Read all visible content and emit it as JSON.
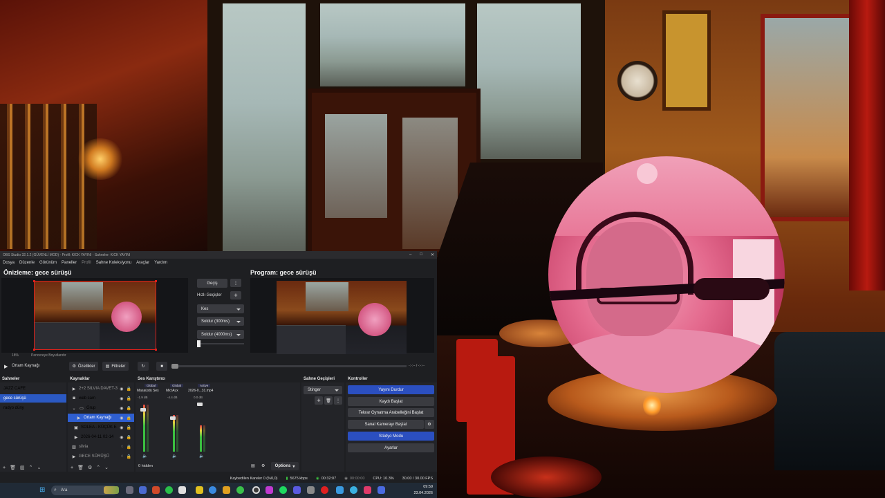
{
  "obs": {
    "title_bar": "OBS Studio 32.1.2 (GÜVENLİ MOD) - Profil: KICK YAYINI - Sahneler: KICK YAYINI",
    "menu": [
      "Dosya",
      "Düzenle",
      "Görünüm",
      "Paneller",
      "Profil",
      "Sahne Koleksiyonu",
      "Araçlar",
      "Yardım"
    ],
    "preview_title": "Önizleme: gece sürüşü",
    "program_title": "Program: gece sürüşü",
    "zoom": "18%",
    "preview_hint": "Pencereye Boyutlandır",
    "transition": {
      "button": "Geçiş",
      "quick_label": "Hızlı Geçişler",
      "items": [
        "Kes",
        "Soldur (300ms)",
        "Soldur (4000ms)"
      ]
    },
    "media": {
      "source": "Ortam Kaynağı",
      "properties": "Özellikler",
      "filters": "Filtreler",
      "time": "-:-:-- / -:-:--"
    },
    "scenes": {
      "header": "Sahneler",
      "items": [
        "JAZZ CAFE",
        "gece sürüşü",
        "radyo düny"
      ],
      "active_index": 1
    },
    "sources": {
      "header": "Kaynaklar",
      "items": [
        {
          "label": "2+2 SILVIA DAVET-3",
          "icon": "play-icon",
          "dim": true
        },
        {
          "label": "web cam",
          "icon": "camera-icon",
          "dim": false
        },
        {
          "label": "Grup",
          "icon": "folder-icon",
          "dim": false
        },
        {
          "label": "Ortam Kaynağı",
          "icon": "play-icon",
          "dim": false,
          "selected": true
        },
        {
          "label": "SOLEA - KÜÇÜK E",
          "icon": "window-icon",
          "dim": false
        },
        {
          "label": "2026-04-11 02-14",
          "icon": "play-icon",
          "dim": false
        },
        {
          "label": "silvia",
          "icon": "image-icon",
          "dim": true
        },
        {
          "label": "GECE SÜRÜŞÜ",
          "icon": "play-icon",
          "dim": true
        }
      ]
    },
    "mixer": {
      "header": "Ses Karıştırıcı",
      "channels": [
        {
          "badge": "Global",
          "name": "Masaüstü Ses",
          "db": "-1.9 dB",
          "level": 0.82
        },
        {
          "badge": "Global",
          "name": "Mic/Aux",
          "db": "-4.4 dB",
          "level": 0.66
        },
        {
          "badge": "Active",
          "name": "2026-0...31.mp4",
          "db": "0.0 dB",
          "level": 0.5
        }
      ],
      "hidden": "0 hidden",
      "options": "Options"
    },
    "transitions_dock": {
      "header": "Sahne Geçişleri",
      "selected": "Stinger"
    },
    "controls": {
      "header": "Kontroller",
      "buttons": [
        "Yayını Durdur",
        "Kaydı Başlat",
        "Tekrar Oynatma Arabelleğini Başlat",
        "Sanal Kamerayı Başlat",
        "Stüdyo Modu",
        "Ayarlar"
      ]
    },
    "status": {
      "dropped": "Kaybedilen Kareler 0 (%0,0)",
      "bitrate": "5675 kbps",
      "stream_time": "00:32:07",
      "rec_time": "00:00:00",
      "cpu": "CPU: 10.3%",
      "fps": "30.00 / 30.00 FPS"
    }
  },
  "taskbar": {
    "search": "Ara",
    "time": "09:59",
    "date": "23.04.2026"
  },
  "colors": {
    "accent_blue": "#2b4fc0",
    "selection_red": "#e0201a",
    "live_green": "#3ac040"
  }
}
